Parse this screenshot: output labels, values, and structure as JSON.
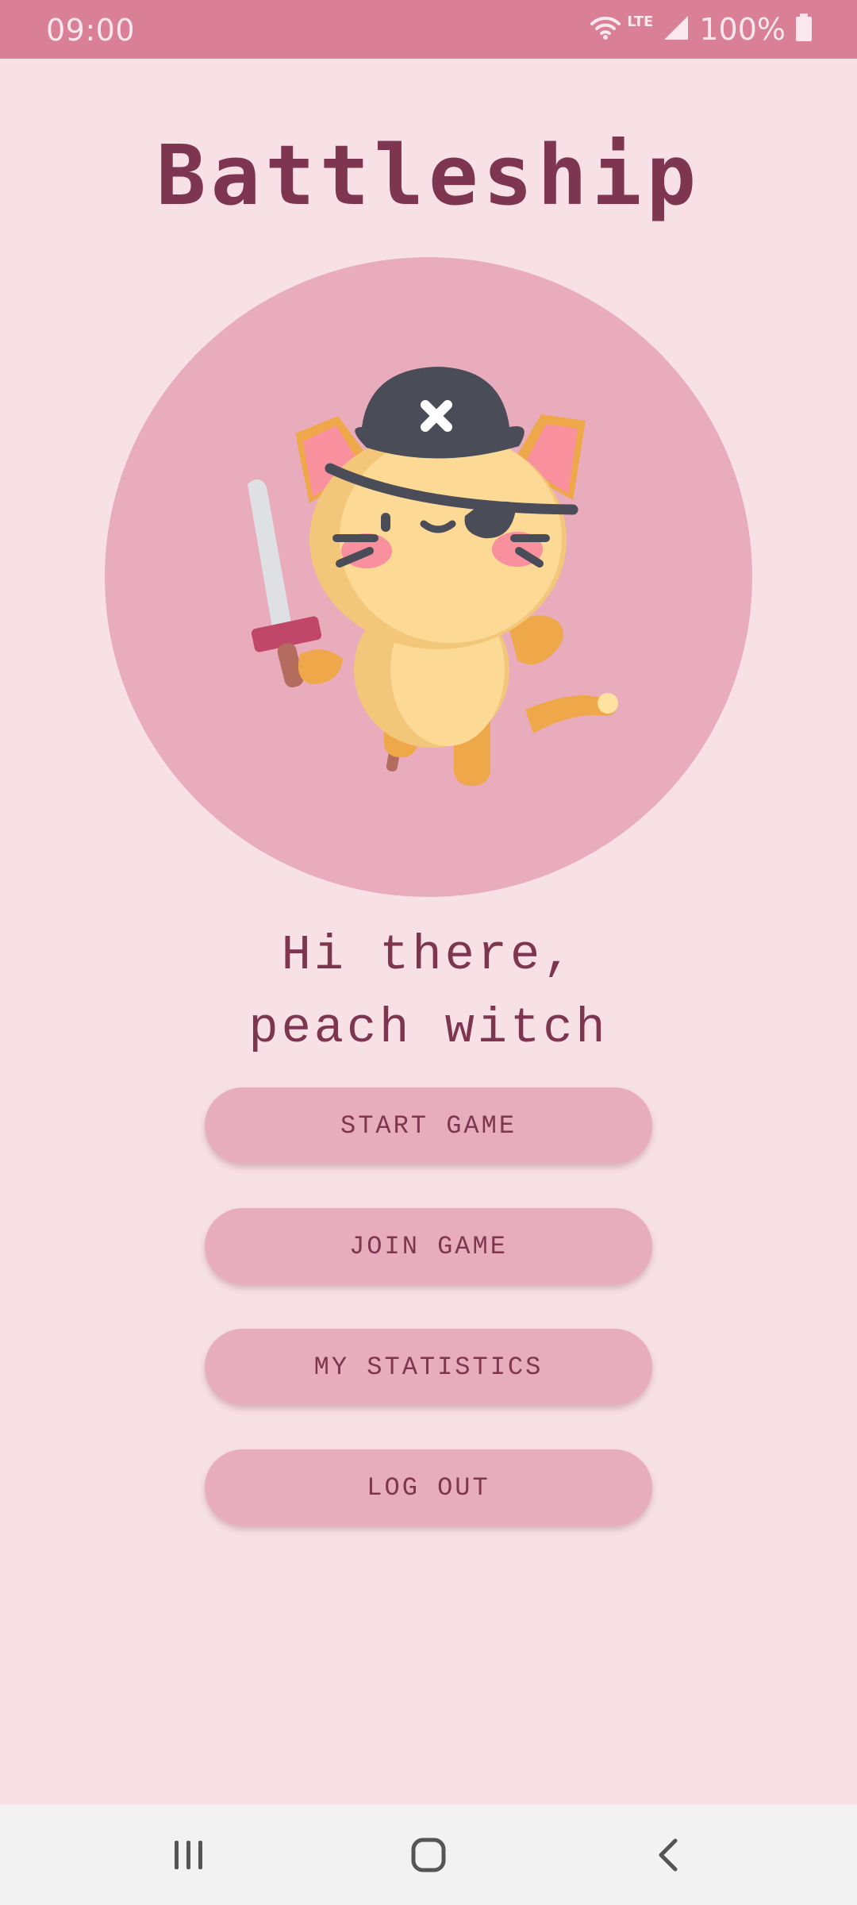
{
  "status_bar": {
    "time": "09:00",
    "network": "LTE",
    "battery": "100%",
    "icons": [
      "wifi-icon",
      "signal-icon",
      "battery-icon"
    ]
  },
  "app": {
    "title": "Battleship",
    "avatar": "pirate-cat-icon"
  },
  "greeting": {
    "line1": "Hi there,",
    "line2": "peach witch"
  },
  "menu": {
    "start_game": "START GAME",
    "join_game": "JOIN GAME",
    "my_statistics": "MY STATISTICS",
    "log_out": "LOG OUT"
  },
  "nav_bar": {
    "icons": [
      "recent-apps-icon",
      "home-icon",
      "back-icon"
    ]
  },
  "colors": {
    "status_bar": "#d97f96",
    "background": "#f7e0e6",
    "accent_pink": "#e9acbd",
    "text": "#7e3550",
    "nav_bar": "#f2f2f2"
  }
}
